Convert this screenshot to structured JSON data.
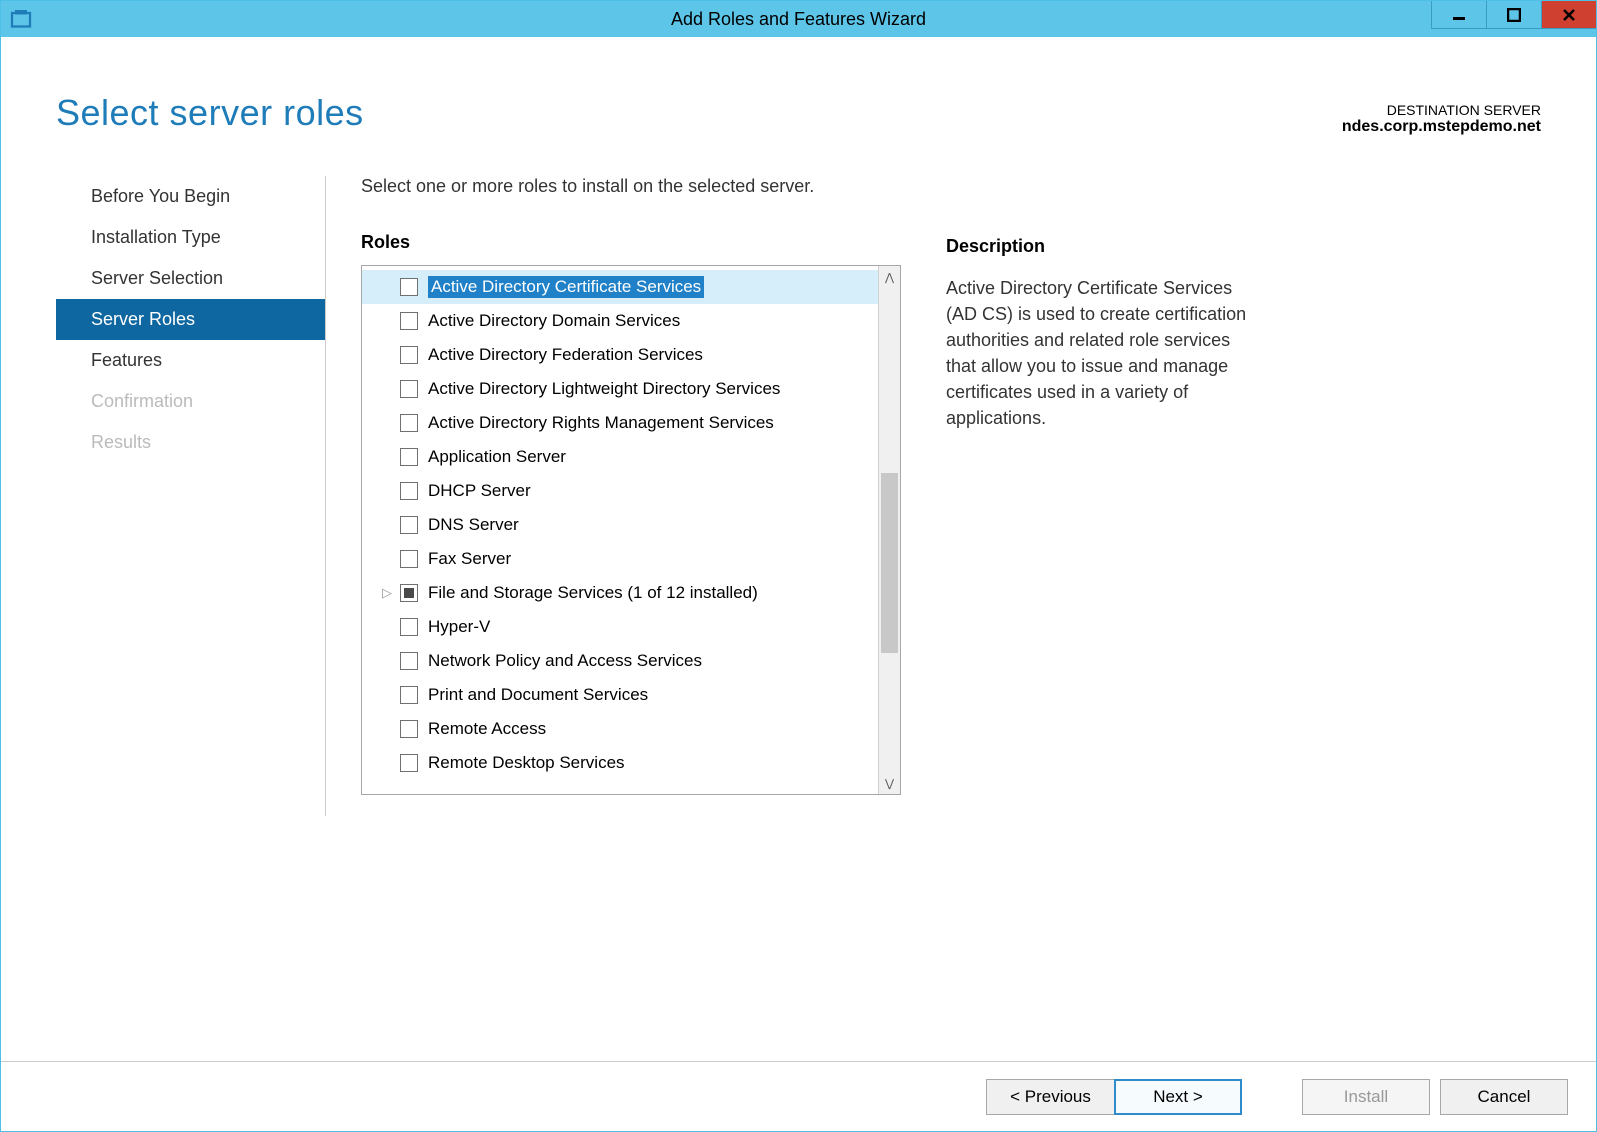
{
  "window": {
    "title": "Add Roles and Features Wizard"
  },
  "header": {
    "page_title": "Select server roles",
    "dest_label": "DESTINATION SERVER",
    "dest_value": "ndes.corp.mstepdemo.net"
  },
  "sidebar": {
    "items": [
      {
        "label": "Before You Begin",
        "state": "normal"
      },
      {
        "label": "Installation Type",
        "state": "normal"
      },
      {
        "label": "Server Selection",
        "state": "normal"
      },
      {
        "label": "Server Roles",
        "state": "active"
      },
      {
        "label": "Features",
        "state": "normal"
      },
      {
        "label": "Confirmation",
        "state": "disabled"
      },
      {
        "label": "Results",
        "state": "disabled"
      }
    ]
  },
  "main": {
    "instruction": "Select one or more roles to install on the selected server.",
    "roles_label": "Roles",
    "roles": [
      {
        "label": "Active Directory Certificate Services",
        "checked": false,
        "selected": true,
        "expandable": false
      },
      {
        "label": "Active Directory Domain Services",
        "checked": false,
        "selected": false,
        "expandable": false
      },
      {
        "label": "Active Directory Federation Services",
        "checked": false,
        "selected": false,
        "expandable": false
      },
      {
        "label": "Active Directory Lightweight Directory Services",
        "checked": false,
        "selected": false,
        "expandable": false
      },
      {
        "label": "Active Directory Rights Management Services",
        "checked": false,
        "selected": false,
        "expandable": false
      },
      {
        "label": "Application Server",
        "checked": false,
        "selected": false,
        "expandable": false
      },
      {
        "label": "DHCP Server",
        "checked": false,
        "selected": false,
        "expandable": false
      },
      {
        "label": "DNS Server",
        "checked": false,
        "selected": false,
        "expandable": false
      },
      {
        "label": "Fax Server",
        "checked": false,
        "selected": false,
        "expandable": false
      },
      {
        "label": "File and Storage Services (1 of 12 installed)",
        "checked": "partial",
        "selected": false,
        "expandable": true
      },
      {
        "label": "Hyper-V",
        "checked": false,
        "selected": false,
        "expandable": false
      },
      {
        "label": "Network Policy and Access Services",
        "checked": false,
        "selected": false,
        "expandable": false
      },
      {
        "label": "Print and Document Services",
        "checked": false,
        "selected": false,
        "expandable": false
      },
      {
        "label": "Remote Access",
        "checked": false,
        "selected": false,
        "expandable": false
      },
      {
        "label": "Remote Desktop Services",
        "checked": false,
        "selected": false,
        "expandable": false
      }
    ]
  },
  "description": {
    "label": "Description",
    "text": "Active Directory Certificate Services (AD CS) is used to create certification authorities and related role services that allow you to issue and manage certificates used in a variety of applications."
  },
  "buttons": {
    "previous": "< Previous",
    "next": "Next >",
    "install": "Install",
    "cancel": "Cancel"
  }
}
